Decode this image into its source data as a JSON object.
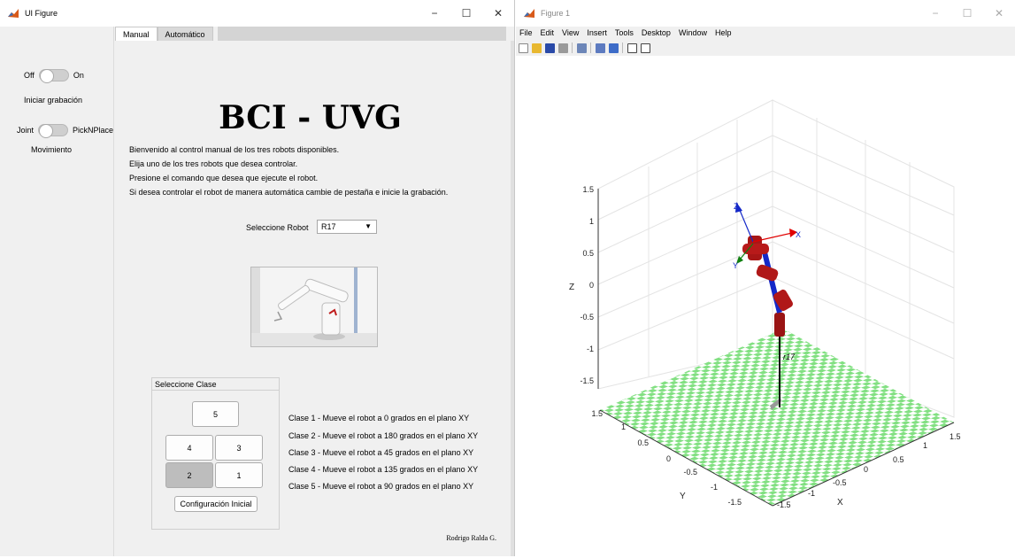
{
  "left_window": {
    "title": "UI Figure",
    "buttons": {
      "min": "−",
      "max": "☐",
      "close": "✕"
    }
  },
  "left_panel": {
    "power_off": "Off",
    "power_on": "On",
    "record_label": "Iniciar grabación",
    "mode_joint": "Joint",
    "mode_pick": "PickNPlace",
    "movement_label": "Movimiento"
  },
  "tabs": [
    {
      "label": "Manual"
    },
    {
      "label": "Automático"
    }
  ],
  "manual": {
    "title": "BCI - UVG",
    "desc": [
      "Bienvenido al control manual de los tres robots disponibles.",
      "Elija uno de los tres robots que desea controlar.",
      "Presione el comando que desea que ejecute el robot.",
      "Si desea controlar el robot de manera automática cambie de pestaña e inicie la grabación."
    ],
    "select_label": "Seleccione Robot",
    "select_value": "R17",
    "panel_title": "Seleccione Clase",
    "btn5": "5",
    "btn4": "4",
    "btn3": "3",
    "btn2": "2",
    "btn1": "1",
    "config_btn": "Configuración Inicial",
    "clases": [
      "Clase 1 - Mueve el robot a 0 grados en el plano XY",
      "Clase 2 - Mueve el robot a 180 grados en el plano XY",
      "Clase 3 - Mueve el robot a 45 grados en el plano XY",
      "Clase 4 - Mueve el robot a 135 grados en el plano XY",
      "Clase 5 - Mueve el robot a 90 grados en el plano XY"
    ],
    "signature": "Rodrigo Ralda G."
  },
  "right_window": {
    "title": "Figure 1",
    "buttons": {
      "min": "−",
      "max": "☐",
      "close": "✕"
    },
    "menu": [
      "File",
      "Edit",
      "View",
      "Insert",
      "Tools",
      "Desktop",
      "Window",
      "Help"
    ]
  },
  "plot": {
    "z_label": "Z",
    "y_label": "Y",
    "x_label": "X",
    "z_ticks": [
      "1.5",
      "1",
      "0.5",
      "0",
      "-0.5",
      "-1",
      "-1.5"
    ],
    "y_ticks": [
      "1.5",
      "1",
      "0.5",
      "0",
      "-0.5",
      "-1",
      "-1.5"
    ],
    "x_ticks": [
      "-1.5",
      "-1",
      "-0.5",
      "0",
      "0.5",
      "1",
      "1.5"
    ],
    "robot_label": "r17",
    "frame_x": "X",
    "frame_y": "Y",
    "frame_z": "Z",
    "colors": {
      "floor_light": "#ffffff",
      "floor_green": "#82e082",
      "link": "#b01818",
      "joint_axis": "#1428c8"
    }
  }
}
